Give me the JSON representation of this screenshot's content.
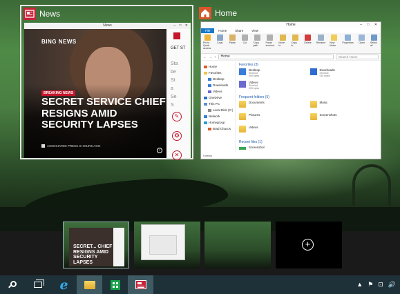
{
  "news_card": {
    "title": "News",
    "window_title": "News",
    "window_controls": "– □ ✕",
    "brand": "BING NEWS",
    "badge": "BREAKING NEWS",
    "headline": "SECRET SERVICE CHIEF RESIGNS AMID SECURITY LAPSES",
    "source": "ASSOCIATED PRESS  3 HOURS AGO",
    "side_heading": "GET ST",
    "side_text": "Sta\nbe\nSt\na\nSe\nS",
    "side_buttons": [
      "✎",
      "✪",
      "✕"
    ],
    "info_glyph": "i"
  },
  "home_card": {
    "title": "Home",
    "window_title": "Home",
    "window_controls": "– □ ✕",
    "tabs": [
      "File",
      "Home",
      "Share",
      "View"
    ],
    "ribbon": [
      {
        "label": "Pin to Quick access",
        "color": "#f2b53a"
      },
      {
        "label": "Copy",
        "color": "#8aa6c8"
      },
      {
        "label": "Paste",
        "color": "#d9b26a"
      },
      {
        "label": "Cut",
        "color": "#b0b0b0"
      },
      {
        "label": "Copy path",
        "color": "#b0b0b0"
      },
      {
        "label": "Paste shortcut",
        "color": "#b0b0b0"
      },
      {
        "label": "Move to",
        "color": "#e1b84f"
      },
      {
        "label": "Copy to",
        "color": "#e1b84f"
      },
      {
        "label": "Delete",
        "color": "#d23b3b"
      },
      {
        "label": "Rename",
        "color": "#9cb0c8"
      },
      {
        "label": "New folder",
        "color": "#f1cc5a"
      },
      {
        "label": "Properties",
        "color": "#8cb0d8"
      },
      {
        "label": "Open",
        "color": "#9bb6d6"
      },
      {
        "label": "Select all",
        "color": "#6f99c8"
      }
    ],
    "ribbon_groups": [
      "Clipboard",
      "Organize",
      "New",
      "Open",
      "Select"
    ],
    "address": "Home",
    "search_placeholder": "Search Home",
    "nav": [
      {
        "label": "Home",
        "sub": false,
        "color": "#d95b2b"
      },
      {
        "label": "Favorites",
        "sub": false,
        "color": "#f2c14e"
      },
      {
        "label": "Desktop",
        "sub": true,
        "color": "#3b7dd8"
      },
      {
        "label": "Downloads",
        "sub": true,
        "color": "#3b7dd8"
      },
      {
        "label": "Videos",
        "sub": true,
        "color": "#6b6bcf"
      },
      {
        "label": "OneDrive",
        "sub": false,
        "color": "#2a6fd1"
      },
      {
        "label": "This PC",
        "sub": false,
        "color": "#5d8fc9"
      },
      {
        "label": "Local Disk (C:)",
        "sub": true,
        "color": "#888888"
      },
      {
        "label": "Network",
        "sub": false,
        "color": "#3b7dd8"
      },
      {
        "label": "Homegroup",
        "sub": false,
        "color": "#2b9bd9"
      },
      {
        "label": "Brad Chacos",
        "sub": true,
        "color": "#d95b2b"
      }
    ],
    "favorites_heading": "Favorites (3)",
    "favorites": [
      {
        "name": "Desktop",
        "meta1": "Shortcut",
        "meta2": "499 bytes",
        "color": "#3b7dd8"
      },
      {
        "name": "Downloads",
        "meta1": "Shortcut",
        "meta2": "910 bytes",
        "color": "#2f6bd0"
      },
      {
        "name": "Videos",
        "meta1": "Shortcut",
        "meta2": "909 bytes",
        "color": "#6b6bcf"
      }
    ],
    "frequent_heading": "Frequent folders (5)",
    "frequent": [
      "Documents",
      "Music",
      "Pictures",
      "Screenshots",
      "Videos"
    ],
    "recent_heading": "Recent files (1)",
    "recent": [
      "Screenshot"
    ],
    "status": "9 items"
  },
  "desktops": {
    "thumb_headline": "SECRET... CHIEF RESIGNS AMID SECURITY LAPSES",
    "add_label": "+"
  },
  "taskbar": {
    "tray_icons": [
      "▲",
      "⚑",
      "⊡",
      "🔊"
    ]
  }
}
